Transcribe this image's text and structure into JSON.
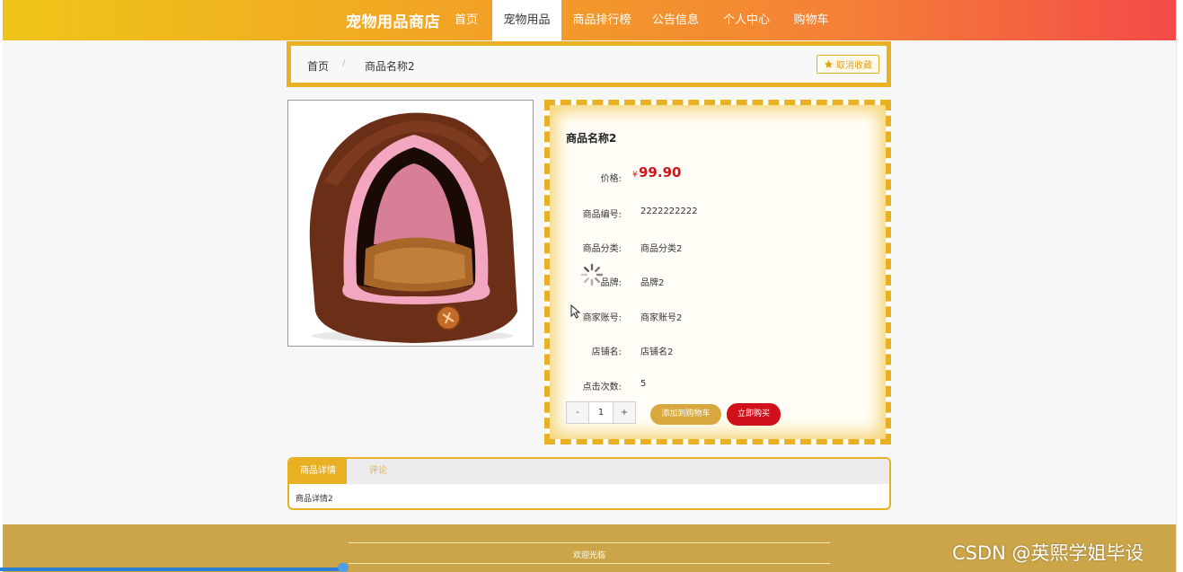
{
  "nav": {
    "brand": "宠物用品商店",
    "items": [
      {
        "label": "首页"
      },
      {
        "label": "宠物用品"
      },
      {
        "label": "商品排行榜"
      },
      {
        "label": "公告信息"
      },
      {
        "label": "个人中心"
      },
      {
        "label": "购物车"
      }
    ],
    "active_index": 1
  },
  "breadcrumb": {
    "home": "首页",
    "separator": "/",
    "current": "商品名称2",
    "favorite_button": "取消收藏"
  },
  "product": {
    "title": "商品名称2",
    "price_symbol": "¥",
    "price": "99.90",
    "fields": [
      {
        "label": "价格:",
        "value": ""
      },
      {
        "label": "商品编号:",
        "value": "2222222222"
      },
      {
        "label": "商品分类:",
        "value": "商品分类2"
      },
      {
        "label": "品牌:",
        "value": "品牌2"
      },
      {
        "label": "商家账号:",
        "value": "商家账号2"
      },
      {
        "label": "店铺名:",
        "value": "店铺名2"
      },
      {
        "label": "点击次数:",
        "value": "5"
      }
    ],
    "quantity": {
      "minus": "-",
      "value": "1",
      "plus": "+"
    },
    "add_to_cart": "添加到购物车",
    "buy_now": "立即购买"
  },
  "tabs": {
    "items": [
      {
        "label": "商品详情"
      },
      {
        "label": "评论"
      }
    ],
    "active_index": 0,
    "content": "商品详情2"
  },
  "footer": {
    "text": "欢迎光临"
  },
  "watermark": "CSDN @英熙学姐毕设",
  "colors": {
    "accent": "#eab023",
    "price": "#d4141b",
    "footer_bg": "#cba548",
    "nav_gradient_start": "#efc519",
    "nav_gradient_end": "#f44a48"
  },
  "icons": [
    "star-icon",
    "loading-spinner-icon",
    "mouse-cursor-icon"
  ]
}
